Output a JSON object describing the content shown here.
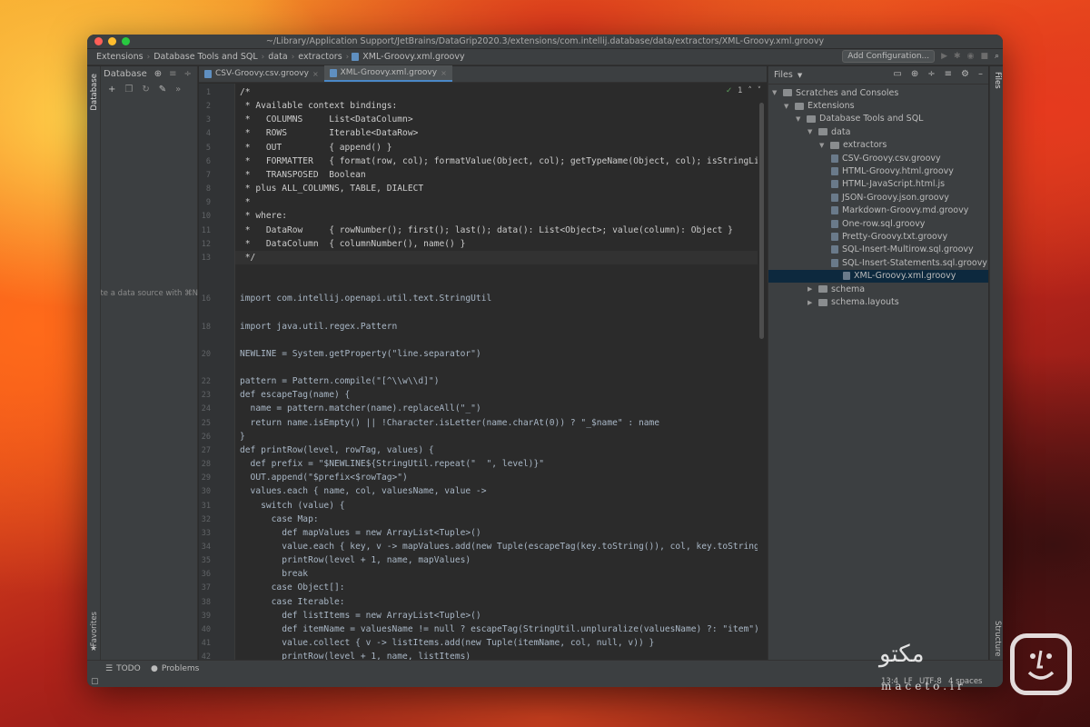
{
  "window": {
    "title": "~/Library/Application Support/JetBrains/DataGrip2020.3/extensions/com.intellij.database/data/extractors/XML-Groovy.xml.groovy"
  },
  "colors": {
    "close": "#ff5f57",
    "minimize": "#febc2e",
    "zoom": "#28c840",
    "accent": "#4a88c7",
    "selection": "#0d293e"
  },
  "navbar": {
    "crumbs": [
      "Extensions",
      "Database Tools and SQL",
      "data",
      "extractors",
      "XML-Groovy.xml.groovy"
    ],
    "add_config": "Add Configuration...",
    "icons": [
      "run-icon",
      "debug-icon",
      "coverage-icon",
      "stop-icon",
      "search-icon"
    ]
  },
  "left_strip": {
    "database_label": "Database",
    "favorites_label": "Favorites"
  },
  "db_panel": {
    "title": "Database",
    "hint": "Create a data source with ⌘N"
  },
  "editor": {
    "tabs": [
      {
        "label": "CSV-Groovy.csv.groovy",
        "active": false
      },
      {
        "label": "XML-Groovy.xml.groovy",
        "active": true
      }
    ],
    "inspection": "1",
    "line_numbers": [
      "1",
      "2",
      "3",
      "4",
      "5",
      "6",
      "7",
      "8",
      "9",
      "10",
      "11",
      "12",
      "13",
      "",
      "",
      "16",
      "",
      "18",
      "",
      "20",
      "",
      "22",
      "23",
      "24",
      "25",
      "26",
      "27",
      "28",
      "29",
      "30",
      "31",
      "32",
      "33",
      "34",
      "35",
      "36",
      "37",
      "38",
      "39",
      "40",
      "41",
      "42"
    ],
    "lines": [
      "/*",
      " * Available context bindings:",
      " *   COLUMNS     List<DataColumn>",
      " *   ROWS        Iterable<DataRow>",
      " *   OUT         { append() }",
      " *   FORMATTER   { format(row, col); formatValue(Object, col); getTypeName(Object, col); isStringLite",
      " *   TRANSPOSED  Boolean",
      " * plus ALL_COLUMNS, TABLE, DIALECT",
      " *",
      " * where:",
      " *   DataRow     { rowNumber(); first(); last(); data(): List<Object>; value(column): Object }",
      " *   DataColumn  { columnNumber(), name() }",
      " */",
      "",
      "",
      "import com.intellij.openapi.util.text.StringUtil",
      "",
      "import java.util.regex.Pattern",
      "",
      "NEWLINE = System.getProperty(\"line.separator\")",
      "",
      "pattern = Pattern.compile(\"[^\\\\w\\\\d]\")",
      "def escapeTag(name) {",
      "  name = pattern.matcher(name).replaceAll(\"_\")",
      "  return name.isEmpty() || !Character.isLetter(name.charAt(0)) ? \"_$name\" : name",
      "}",
      "def printRow(level, rowTag, values) {",
      "  def prefix = \"$NEWLINE${StringUtil.repeat(\"  \", level)}\"",
      "  OUT.append(\"$prefix<$rowTag>\")",
      "  values.each { name, col, valuesName, value ->",
      "    switch (value) {",
      "      case Map:",
      "        def mapValues = new ArrayList<Tuple>()",
      "        value.each { key, v -> mapValues.add(new Tuple(escapeTag(key.toString()), col, key.toString()",
      "        printRow(level + 1, name, mapValues)",
      "        break",
      "      case Object[]:",
      "      case Iterable:",
      "        def listItems = new ArrayList<Tuple>()",
      "        def itemName = valuesName != null ? escapeTag(StringUtil.unpluralize(valuesName) ?: \"item\") :",
      "        value.collect { v -> listItems.add(new Tuple(itemName, col, null, v)) }",
      "        printRow(level + 1, name, listItems)"
    ]
  },
  "files_panel": {
    "title": "Files",
    "tree": [
      {
        "label": "Scratches and Consoles",
        "depth": 0,
        "kind": "folder",
        "open": true
      },
      {
        "label": "Extensions",
        "depth": 1,
        "kind": "folder",
        "open": true
      },
      {
        "label": "Database Tools and SQL",
        "depth": 2,
        "kind": "folder",
        "open": true
      },
      {
        "label": "data",
        "depth": 3,
        "kind": "folder",
        "open": true
      },
      {
        "label": "extractors",
        "depth": 4,
        "kind": "folder",
        "open": true
      },
      {
        "label": "CSV-Groovy.csv.groovy",
        "depth": 5,
        "kind": "file"
      },
      {
        "label": "HTML-Groovy.html.groovy",
        "depth": 5,
        "kind": "file"
      },
      {
        "label": "HTML-JavaScript.html.js",
        "depth": 5,
        "kind": "file"
      },
      {
        "label": "JSON-Groovy.json.groovy",
        "depth": 5,
        "kind": "file"
      },
      {
        "label": "Markdown-Groovy.md.groovy",
        "depth": 5,
        "kind": "file"
      },
      {
        "label": "One-row.sql.groovy",
        "depth": 5,
        "kind": "file"
      },
      {
        "label": "Pretty-Groovy.txt.groovy",
        "depth": 5,
        "kind": "file"
      },
      {
        "label": "SQL-Insert-Multirow.sql.groovy",
        "depth": 5,
        "kind": "file"
      },
      {
        "label": "SQL-Insert-Statements.sql.groovy",
        "depth": 5,
        "kind": "file"
      },
      {
        "label": "XML-Groovy.xml.groovy",
        "depth": 5,
        "kind": "file",
        "selected": true
      },
      {
        "label": "schema",
        "depth": 3,
        "kind": "folder",
        "open": false
      },
      {
        "label": "schema.layouts",
        "depth": 3,
        "kind": "folder",
        "open": false
      }
    ]
  },
  "right_strip": {
    "files_label": "Files",
    "structure_label": "Structure"
  },
  "status": {
    "todo": "TODO",
    "problems": "Problems",
    "position": "13:4",
    "line_sep": "LF",
    "encoding": "UTF-8",
    "indent": "4 spaces"
  },
  "watermark": {
    "brand": "مکتو",
    "sub": "maceto.ir"
  }
}
